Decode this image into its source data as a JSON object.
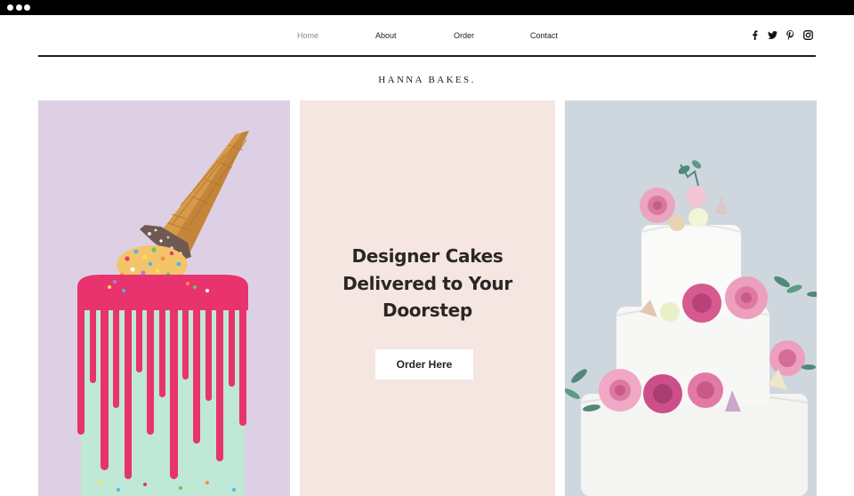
{
  "nav": {
    "items": [
      {
        "label": "Home",
        "active": true
      },
      {
        "label": "About",
        "active": false
      },
      {
        "label": "Order",
        "active": false
      },
      {
        "label": "Contact",
        "active": false
      }
    ],
    "social": [
      "facebook-icon",
      "twitter-icon",
      "pinterest-icon",
      "instagram-icon"
    ]
  },
  "brand": {
    "name": "HANNA BAKES."
  },
  "hero": {
    "headline_lines": [
      "Designer Cakes",
      "Delivered to Your",
      "Doorstep"
    ],
    "cta_label": "Order Here"
  },
  "images": {
    "left": "ice-cream-cone-drip-cake-photo",
    "right": "white-tiered-cake-with-roses-photo"
  },
  "colors": {
    "left_bg": "#ddd0e4",
    "middle_bg": "#f5e6e1",
    "right_bg": "#cfd7de",
    "drip_pink": "#e8336f",
    "mint": "#bfe8d6"
  }
}
